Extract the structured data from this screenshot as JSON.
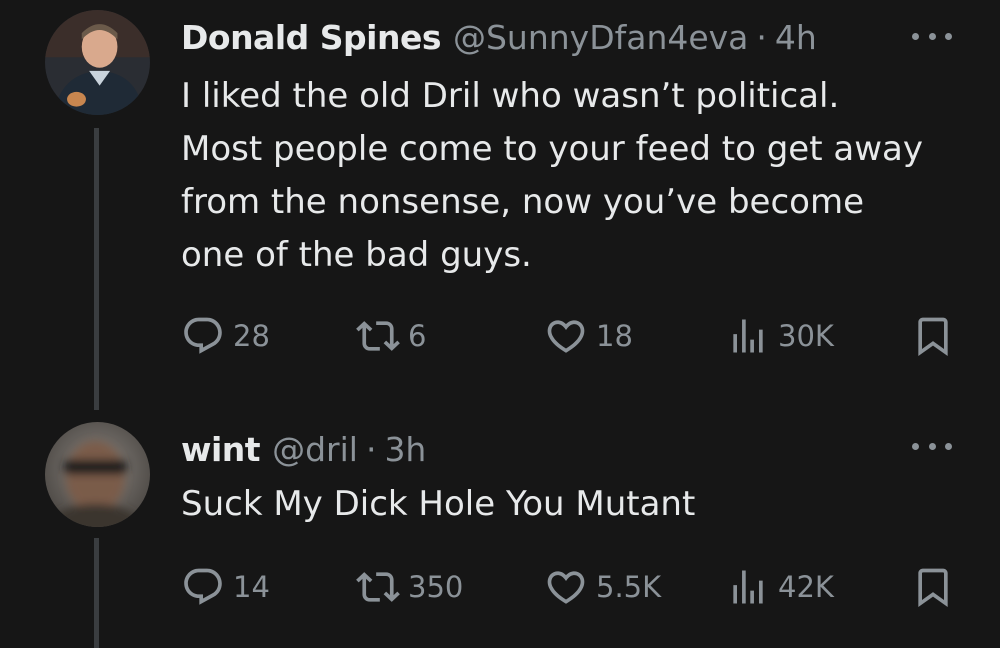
{
  "tweets": [
    {
      "name": "Donald Spines",
      "handle": "@SunnyDfan4eva",
      "separator": "·",
      "time": "4h",
      "lines": [
        "I liked the old Dril who wasn’t political.",
        "Most people come to your feed to get away",
        "from the nonsense, now you’ve become",
        "one of the bad guys."
      ],
      "replies": "28",
      "retweets": "6",
      "likes": "18",
      "views": "30K"
    },
    {
      "name": "wint",
      "handle": "@dril",
      "separator": "·",
      "time": "3h",
      "lines": [
        "Suck My Dick Hole You Mutant"
      ],
      "replies": "14",
      "retweets": "350",
      "likes": "5.5K",
      "views": "42K"
    }
  ],
  "icons": {
    "reply": "reply-icon",
    "retweet": "retweet-icon",
    "like": "heart-icon",
    "views": "views-icon",
    "bookmark": "bookmark-icon",
    "more": "more-icon"
  },
  "colors": {
    "background": "#161616",
    "text": "#e7e9ea",
    "muted": "#8b9298",
    "thread_line": "#3a3d40"
  }
}
